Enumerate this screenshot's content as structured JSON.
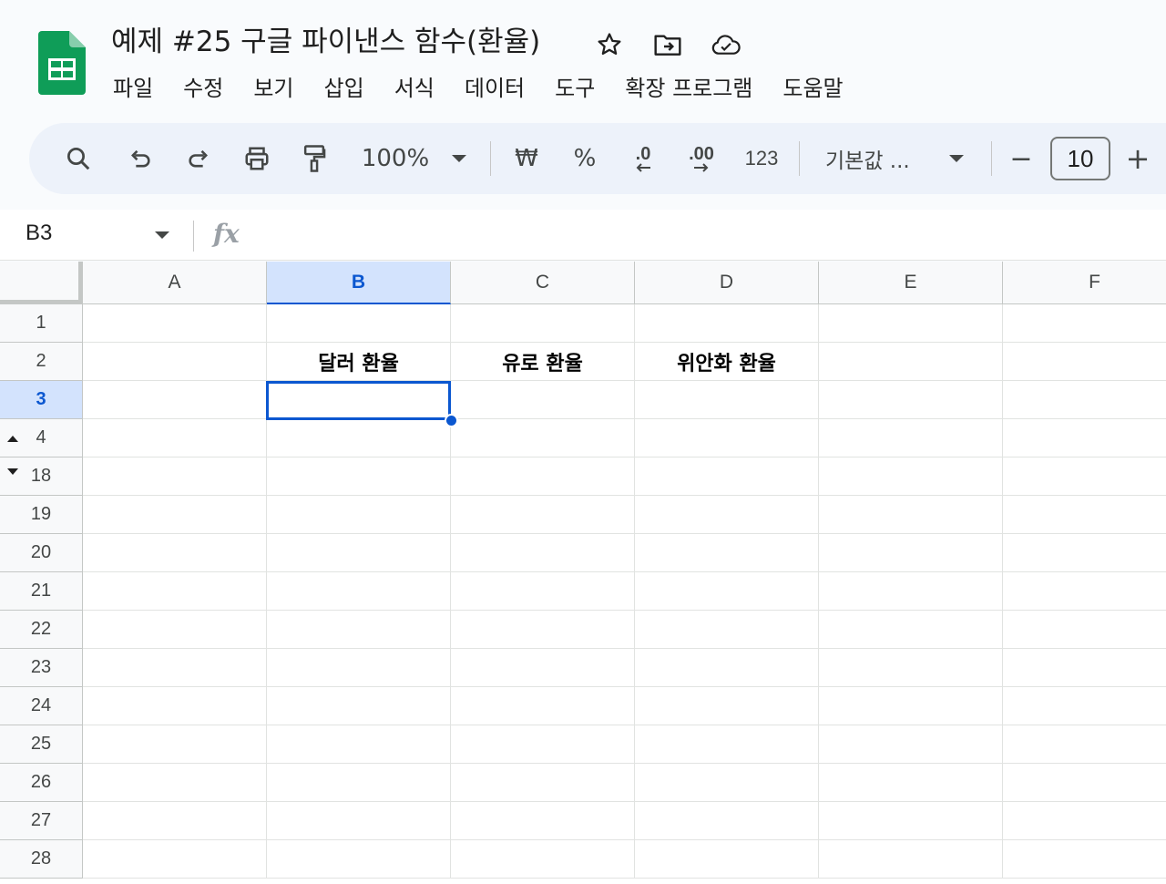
{
  "document": {
    "title": "예제 #25 구글 파이낸스 함수(환율)"
  },
  "menu": [
    "파일",
    "수정",
    "보기",
    "삽입",
    "서식",
    "데이터",
    "도구",
    "확장 프로그램",
    "도움말"
  ],
  "toolbar": {
    "zoom": "100%",
    "currency": "₩",
    "percent": "%",
    "decrease_decimal": ".0",
    "increase_decimal": ".00",
    "number_format": "123",
    "font_name": "기본값 ...",
    "font_size": "10",
    "minus": "−",
    "plus": "+"
  },
  "formula_bar": {
    "cell_ref": "B3",
    "fx": "fx",
    "value": ""
  },
  "columns": [
    "A",
    "B",
    "C",
    "D",
    "E",
    "F"
  ],
  "rows": [
    "1",
    "2",
    "3",
    "4",
    "18",
    "19",
    "20",
    "21",
    "22",
    "23",
    "24",
    "25",
    "26",
    "27",
    "28"
  ],
  "cells": {
    "B2": "달러 환율",
    "C2": "유로 환율",
    "D2": "위안화 환율"
  },
  "colors": {
    "accent": "#0b57d0",
    "selected_header": "#d3e3fd",
    "logo_green": "#0f9d58"
  }
}
